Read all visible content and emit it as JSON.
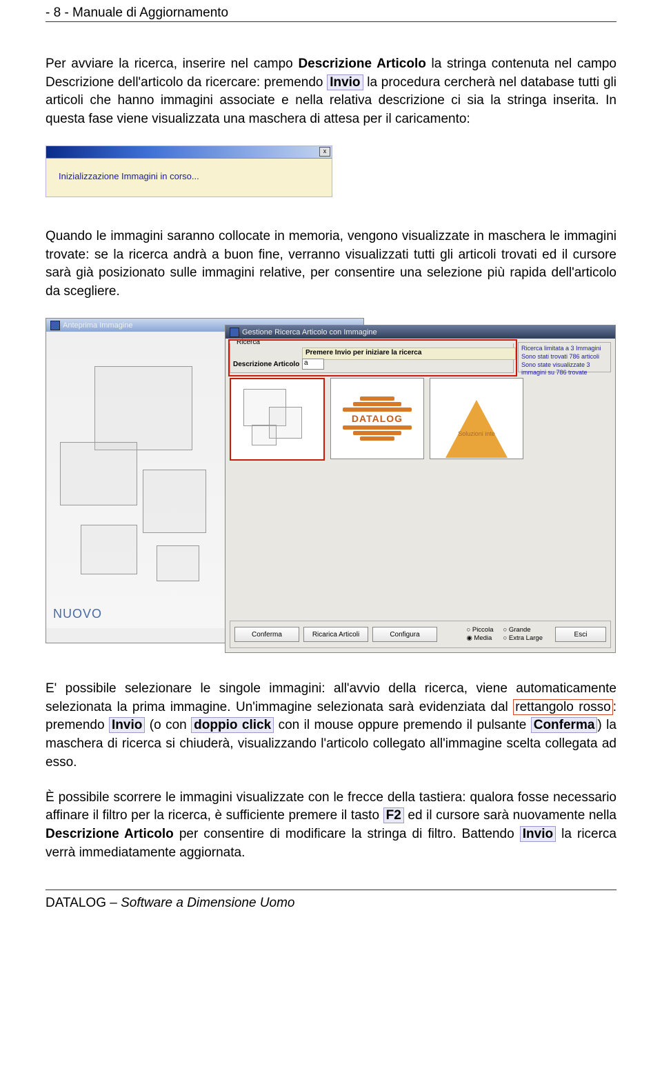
{
  "header": "- 8 -  Manuale di Aggiornamento",
  "para1": {
    "t1": "Per avviare la ricerca, inserire nel campo ",
    "b1": "Descrizione Articolo",
    "t2": " la stringa contenuta nel campo Descrizione dell'articolo da ricercare: premendo ",
    "k1": "Invio",
    "t3": " la procedura cercherà nel database tutti gli articoli che hanno immagini associate e nella relativa descrizione ci sia la stringa inserita. In questa fase viene visualizzata una maschera di attesa per il caricamento:"
  },
  "init_dialog": {
    "text": "Inizializzazione Immagini in corso...",
    "close": "x"
  },
  "para2": "Quando le immagini saranno collocate in memoria, vengono visualizzate in maschera le immagini trovate: se la ricerca andrà a buon fine, verranno visualizzati tutti gli articoli trovati ed il cursore sarà già posizionato sulle immagini relative, per consentire una selezione più rapida dell'articolo da scegliere.",
  "preview_win": {
    "title": "Anteprima Immagine",
    "nuovo": "NUOVO"
  },
  "search_win": {
    "title": "Gestione Ricerca Articolo con Immagine",
    "group_legend": "Ricerca",
    "hint": "Premere Invio per iniziare la ricerca",
    "desc_label": "Descrizione Articolo",
    "desc_value": "a",
    "status1": "Ricerca limitata a 3 Immagini",
    "status2": "Sono stati trovati 786 articoli",
    "status3": "Sono state visualizzate 3 immagini su 786 trovate",
    "thumb2_word": "DATALOG",
    "thumb3_caption": "Soluzioni inte",
    "btn_conferma": "Conferma",
    "btn_ricarica": "Ricarica Articoli",
    "btn_configura": "Configura",
    "btn_esci": "Esci",
    "radio_piccola": "Piccola",
    "radio_media": "Media",
    "radio_grande": "Grande",
    "radio_extra": "Extra Large"
  },
  "para3": {
    "t1": "E' possibile selezionare le singole immagini: all'avvio della ricerca, viene automaticamente selezionata la prima immagine. Un'immagine selezionata sarà evidenziata dal ",
    "r1": "rettangolo rosso",
    "t2": ": premendo ",
    "k1": "Invio",
    "t3": " (o con ",
    "k2": "doppio click",
    "t4": " con il mouse oppure premendo il pulsante ",
    "k3": "Conferma",
    "t5": ") la maschera di ricerca si chiuderà, visualizzando l'articolo collegato all'immagine scelta collegata ad esso."
  },
  "para4": {
    "t1": "È possibile scorrere le immagini visualizzate con le frecce della tastiera: qualora fosse necessario affinare il filtro per la ricerca, è sufficiente premere il tasto ",
    "k1": "F2",
    "t2": " ed il cursore sarà nuovamente nella ",
    "b1": "Descrizione Articolo",
    "t3": " per consentire di modificare la stringa di filtro. Battendo ",
    "k2": "Invio",
    "t4": " la ricerca verrà immediatamente aggiornata."
  },
  "footer": {
    "brand": "DATALOG",
    "tag": " – Software a Dimensione Uomo"
  }
}
